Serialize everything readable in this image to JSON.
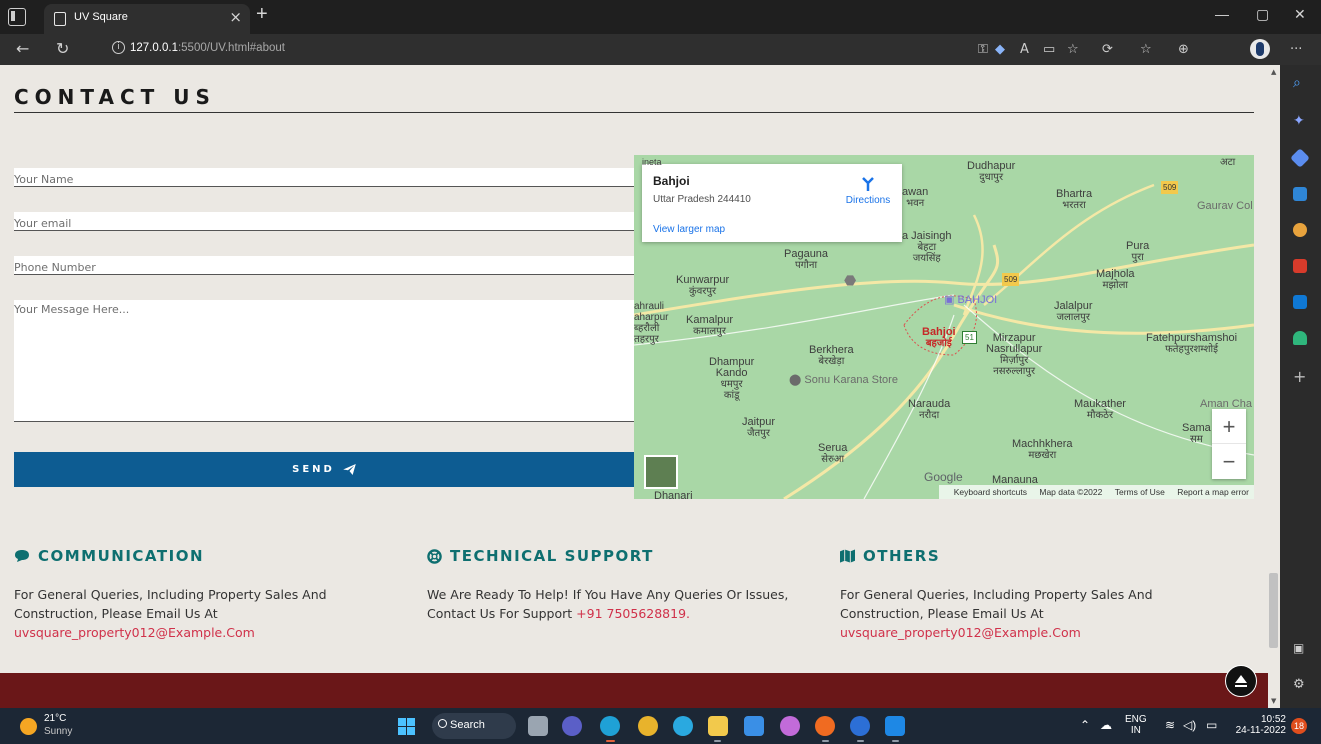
{
  "browser": {
    "tab_title": "UV Square",
    "new_tab_label": "+",
    "url_host": "127.0.0.1",
    "url_rest": ":5500/UV.html#about"
  },
  "page": {
    "section_title": "CONTACT US",
    "form": {
      "name_placeholder": "Your Name",
      "email_placeholder": "Your email",
      "phone_placeholder": "Phone Number",
      "message_placeholder": "Your Message Here...",
      "send_label": "SEND"
    },
    "map": {
      "place_name": "Bahjoi",
      "place_address": "Uttar Pradesh 244410",
      "directions_label": "Directions",
      "larger_map_label": "View larger map",
      "google_label": "Google",
      "footer_shortcuts": "Keyboard shortcuts",
      "footer_data": "Map data ©2022",
      "footer_terms": "Terms of Use",
      "footer_report": "Report a map error",
      "zoom_in": "+",
      "zoom_out": "−",
      "labels": {
        "dudhapur": "Dudhapur",
        "dudhapur_hi": "दुधापुर",
        "bhartra": "Bhartra",
        "bhartra_hi": "भरतरा",
        "gaurav": "Gaurav Col",
        "jaisingh": "a Jaisingh",
        "jaisingh_hi1": "बेहटा",
        "jaisingh_hi2": "जयसिंह",
        "pura": "Pura",
        "pura_hi": "पुरा",
        "pagauna": "Pagauna",
        "pagauna_hi": "पगौना",
        "majhola": "Majhola",
        "majhola_hi": "मझोला",
        "kunwarpur": "Kunwarpur",
        "kunwarpur_hi": "कुंवरपुर",
        "bahjoi_pin": "BAHJOI",
        "jalalpur": "Jalalpur",
        "jalalpur_hi": "जलालपुर",
        "sahrauli_1": "ahrauli",
        "sahrauli_2": "aharpur",
        "sahrauli_3": "ब्हरौली",
        "sahrauli_4": "तहरपुर",
        "kamalpur": "Kamalpur",
        "kamalpur_hi": "कमालपुर",
        "bahjoi_red": "Bahjoi",
        "bahjoi_red_hi": "बहजोई",
        "mirzapur": "Mirzapur",
        "nasrullapur": "Nasrullapur",
        "mirzapur_hi": "मिर्ज़ापुर",
        "nasrullapur_hi": "नसरुल्लापुर",
        "fatehpur": "Fatehpurshamshoi",
        "fatehpur_hi": "फतेहपुरशम्शोई",
        "berkhera": "Berkhera",
        "berkhera_hi": "बेरखेड़ा",
        "dhampur_1": "Dhampur",
        "dhampur_2": "Kando",
        "dhampur_hi1": "धमपुर",
        "dhampur_hi2": "कांडू",
        "sonu": "Sonu Karana Store",
        "narauda": "Narauda",
        "narauda_hi": "नरौदा",
        "maukather": "Maukather",
        "maukather_hi": "मौकठेर",
        "aman": "Aman Cha",
        "jaitpur": "Jaitpur",
        "jaitpur_hi": "जैतपुर",
        "sama": "Sama",
        "sama_hi": "सम",
        "machhkhera": "Machhkhera",
        "machhkhera_hi": "मछखेरा",
        "serua": "Serua",
        "serua_hi": "सेरुआ",
        "manauna": "Manauna",
        "dhanari": "Dhanari",
        "road_509a": "509",
        "road_509b": "509",
        "road_51": "51",
        "top_partial": "ineta",
        "top_right": "अटा"
      }
    },
    "columns": [
      {
        "title": "COMMUNICATION",
        "text": "For General Queries, Including Property Sales And Construction, Please Email Us At",
        "accent": "uvsquare_property012@Example.Com"
      },
      {
        "title": "TECHNICAL SUPPORT",
        "text": "We Are Ready To Help! If You Have Any Queries Or Issues, Contact Us For Support",
        "accent": "+91 7505628819."
      },
      {
        "title": "OTHERS",
        "text": "For General Queries, Including Property Sales And Construction, Please Email Us At",
        "accent": "uvsquare_property012@Example.Com"
      }
    ]
  },
  "taskbar": {
    "temp": "21°C",
    "condition": "Sunny",
    "search_label": "Search",
    "lang_1": "ENG",
    "lang_2": "IN",
    "time": "10:52",
    "date": "24-11-2022",
    "notifications": "18"
  },
  "colors": {
    "page_bg": "#ebe8e3",
    "send_button": "#0d5c92",
    "column_heading": "#0e6f70",
    "accent_text": "#d0314a",
    "footer_bar": "#6a1718"
  }
}
